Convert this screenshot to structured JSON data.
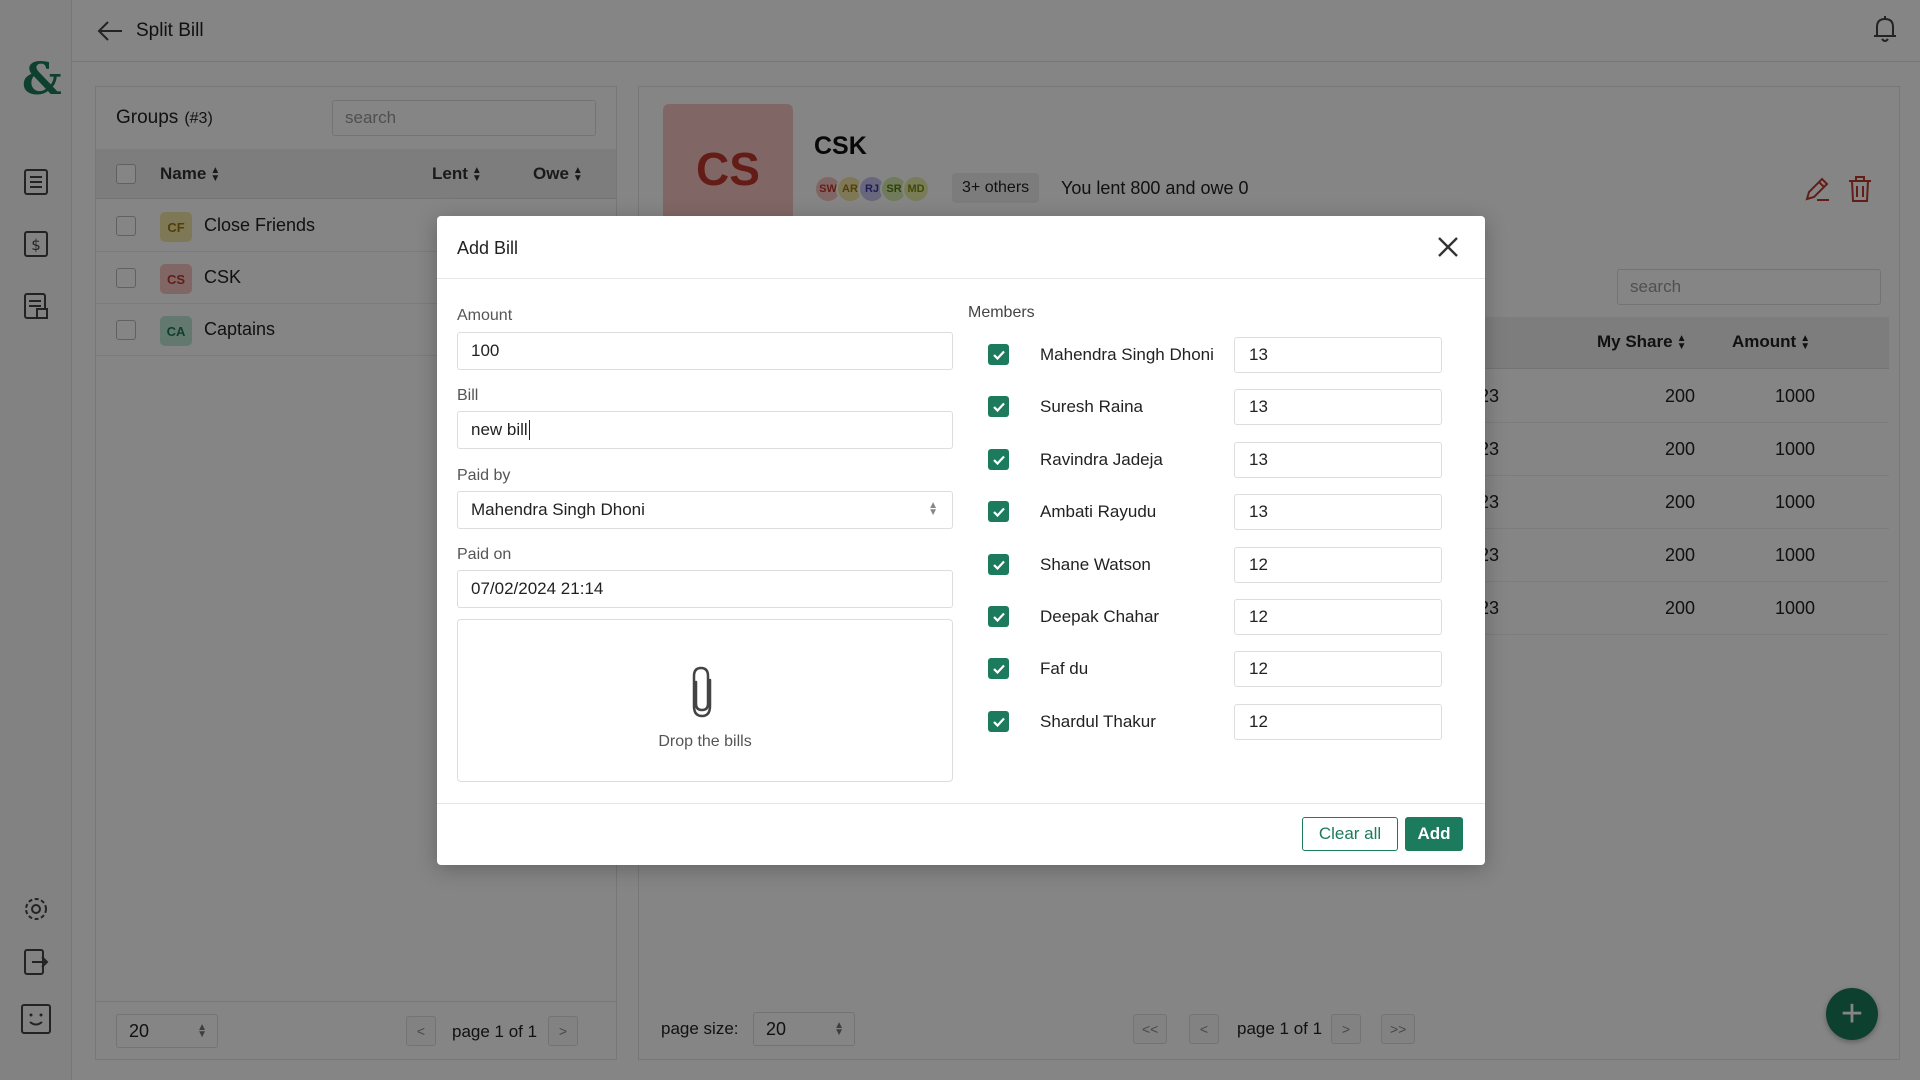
{
  "topbar": {
    "title": "Split Bill"
  },
  "sidebar": {
    "logo": "&"
  },
  "groups": {
    "heading": "Groups",
    "count": "(#3)",
    "search_placeholder": "search",
    "columns": {
      "name": "Name",
      "lent": "Lent",
      "owe": "Owe"
    },
    "rows": [
      {
        "initials": "CF",
        "name": "Close Friends"
      },
      {
        "initials": "CS",
        "name": "CSK"
      },
      {
        "initials": "CA",
        "name": "Captains"
      }
    ],
    "footer": {
      "page_size": "20",
      "prev": "<",
      "page_label": "page 1 of 1",
      "next": ">"
    }
  },
  "detail": {
    "badge": "CS",
    "title": "CSK",
    "avatars": [
      "SW",
      "AR",
      "RJ",
      "SR",
      "MD"
    ],
    "others": "3+ others",
    "summary": "You lent 800 and owe 0",
    "search_placeholder": "search",
    "columns": {
      "my_share": "My Share",
      "amount": "Amount"
    },
    "rows": [
      {
        "date_tail": "23",
        "my_share": "200",
        "amount": "1000"
      },
      {
        "date_tail": "23",
        "my_share": "200",
        "amount": "1000"
      },
      {
        "date_tail": "23",
        "my_share": "200",
        "amount": "1000"
      },
      {
        "date_tail": "23",
        "my_share": "200",
        "amount": "1000"
      },
      {
        "date_tail": "23",
        "my_share": "200",
        "amount": "1000"
      }
    ],
    "footer": {
      "page_size_label": "page size:",
      "page_size": "20",
      "first": "<<",
      "prev": "<",
      "page_label": "page 1 of 1",
      "next": ">",
      "last": ">>"
    },
    "fab": "+"
  },
  "modal": {
    "title": "Add Bill",
    "amount_label": "Amount",
    "amount_value": "100",
    "bill_label": "Bill",
    "bill_value": "new bill",
    "paid_by_label": "Paid by",
    "paid_by_value": "Mahendra Singh Dhoni",
    "paid_on_label": "Paid on",
    "paid_on_value": "07/02/2024 21:14",
    "drop_text": "Drop the bills",
    "members_label": "Members",
    "members": [
      {
        "name": "Mahendra Singh Dhoni",
        "share": "13",
        "checked": true
      },
      {
        "name": "Suresh Raina",
        "share": "13",
        "checked": true
      },
      {
        "name": "Ravindra Jadeja",
        "share": "13",
        "checked": true
      },
      {
        "name": "Ambati Rayudu",
        "share": "13",
        "checked": true
      },
      {
        "name": "Shane Watson",
        "share": "12",
        "checked": true
      },
      {
        "name": "Deepak Chahar",
        "share": "12",
        "checked": true
      },
      {
        "name": "Faf du",
        "share": "12",
        "checked": true
      },
      {
        "name": "Shardul Thakur",
        "share": "12",
        "checked": true
      }
    ],
    "clear_label": "Clear all",
    "add_label": "Add"
  },
  "colors": {
    "accent": "#1b7b5c",
    "danger": "#c0392b",
    "overlay": "rgba(0,0,0,0.48)"
  }
}
